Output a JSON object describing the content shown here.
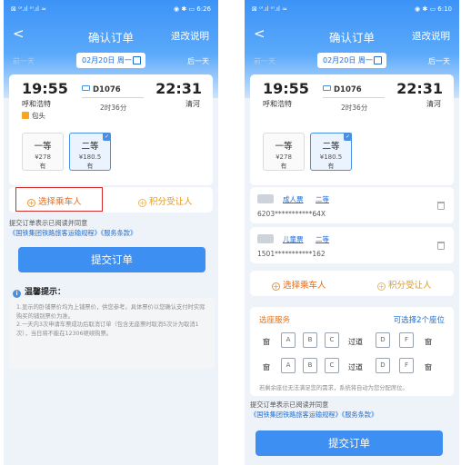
{
  "screen1": {
    "status_left": "⊠ ᵒᴵ.ıl ᵒᴵ.ıl ≈",
    "status_right": "◉ ✱ ▭ 6:26",
    "back": "<",
    "title": "确认订单",
    "refund": "退改说明",
    "prev_day": "前一天",
    "date": "02月20日 周一",
    "next_day": "后一天",
    "dep_time": "19:55",
    "dep_station": "呼和浩特",
    "train_no": "D1076",
    "duration": "2时36分",
    "arr_time": "22:31",
    "arr_station": "清河",
    "via_station": "包头",
    "seats": [
      {
        "name": "一等",
        "price": "¥278",
        "avail": "有"
      },
      {
        "name": "二等",
        "price": "¥180.5",
        "avail": "有"
      }
    ],
    "select_passenger": "选择乘车人",
    "points_beneficiary": "积分受让人",
    "agree_text": "提交订单表示已阅读并同意",
    "agree_link": "《国铁集团铁路旅客运输规程》《服务条款》",
    "submit": "提交订单",
    "tips_title": "温馨提示：",
    "tips_lines": [
      "1.显示的卧铺票价均为上铺票价，供您参考。具体票价以您确认支付时实际购买的铺别票价为准。",
      "2.一天内3次申请车票成功后取消订单（包含无座票时取消5次计为取消1次），当日将不能在12306继续购票。"
    ]
  },
  "screen2": {
    "status_left": "⊠ ᵒᴵ.ıl ᵒᴵ.ıl ≈",
    "status_right": "◉ ✱ ▭ 6:10",
    "back": "<",
    "title": "确认订单",
    "refund": "退改说明",
    "prev_day": "前一天",
    "date": "02月20日 周一",
    "next_day": "后一天",
    "dep_time": "19:55",
    "dep_station": "呼和浩特",
    "train_no": "D1076",
    "duration": "2时36分",
    "arr_time": "22:31",
    "arr_station": "清河",
    "seats": [
      {
        "name": "一等",
        "price": "¥278",
        "avail": "有"
      },
      {
        "name": "二等",
        "price": "¥180.5",
        "avail": "有"
      }
    ],
    "passengers": [
      {
        "type": "成人票",
        "seat": "二等",
        "id": "6203***********64X"
      },
      {
        "type": "儿童票",
        "seat": "二等",
        "id": "1501***********162"
      }
    ],
    "select_passenger": "选择乘车人",
    "points_beneficiary": "积分受让人",
    "seat_service": "选座服务",
    "seat_available": "可选择2个座位",
    "window": "窗",
    "aisle": "过道",
    "seat_letters": [
      "A",
      "B",
      "C",
      "D",
      "F"
    ],
    "seat_note": "若剩余座位无法满足您的需求，系统将自动为您分配席位。",
    "agree_text": "提交订单表示已阅读并同意",
    "agree_link": "《国铁集团铁路旅客运输规程》《服务条款》",
    "submit": "提交订单"
  }
}
